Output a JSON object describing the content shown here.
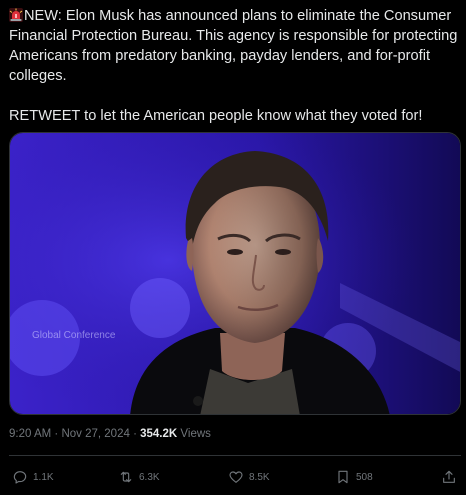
{
  "post": {
    "line1": "NEW: Elon Musk has announced plans to eliminate the Consumer",
    "line2": "Financial Protection Bureau. This agency is responsible for protecting",
    "line3": "Americans from predatory banking, payday lenders, and for-profit",
    "line4": "colleges.",
    "line5": "RETWEET to let the American people know what they voted for!",
    "lead_icon": "siren-emoji",
    "media": {
      "type": "photo",
      "backdrop_text": "Global Conference"
    }
  },
  "meta": {
    "time": "9:20 AM",
    "separator": "·",
    "date": "Nov 27, 2024",
    "views_count": "354.2K",
    "views_label": "Views"
  },
  "actions": {
    "replies": "1.1K",
    "reposts": "6.3K",
    "likes": "8.5K",
    "bookmarks": "508"
  },
  "colors": {
    "background": "#000000",
    "text": "#e7e9ea",
    "muted": "#71767b",
    "border": "#2f3336",
    "siren": "#e0303b"
  }
}
